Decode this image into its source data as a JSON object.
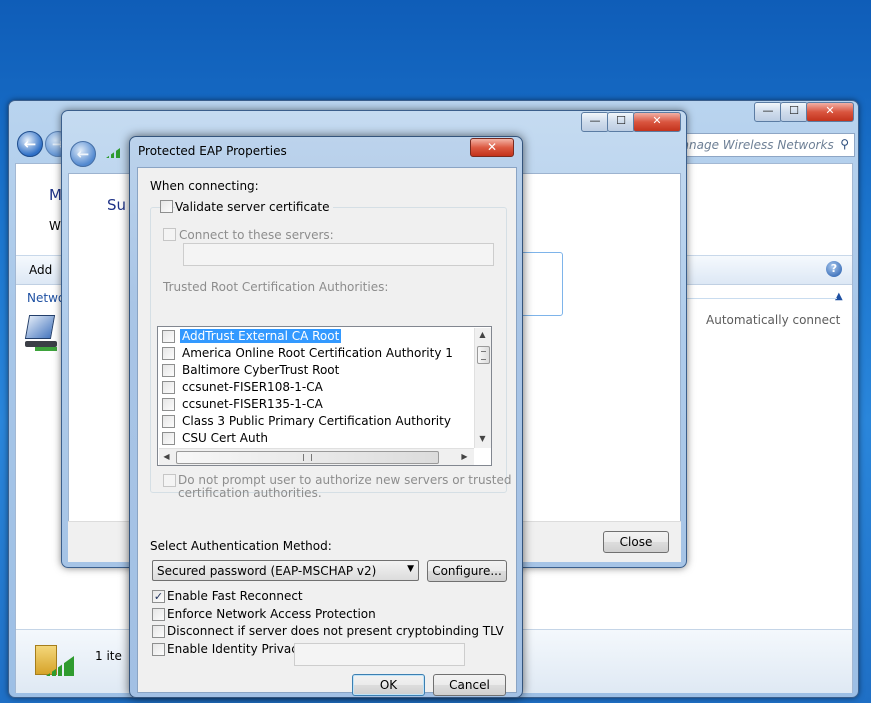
{
  "back_window": {
    "search_placeholder": "Search Manage Wireless Networks",
    "title_partial": "M",
    "subtitle_partial": "W",
    "toolbar_add": "Add",
    "networks_label_partial": "Netwo",
    "column_header": "Automatically connect",
    "status_count_partial": "1 ite",
    "caption_buttons": {
      "minimize": "—",
      "maximize": "☐",
      "close": "✕"
    }
  },
  "mid_window": {
    "heading_partial": "Su",
    "close_button": "Close",
    "caption_buttons": {
      "minimize": "—",
      "maximize": "☐",
      "close": "✕"
    }
  },
  "dialog": {
    "title": "Protected EAP Properties",
    "close_glyph": "✕",
    "when_connecting": "When connecting:",
    "validate_cert": {
      "label": "Validate server certificate",
      "checked": false
    },
    "connect_servers": {
      "label": "Connect to these servers:",
      "checked": false,
      "value": ""
    },
    "trusted_root_label": "Trusted Root Certification Authorities:",
    "ca_list": [
      {
        "name": "AddTrust External CA Root",
        "checked": false,
        "selected": true
      },
      {
        "name": "America Online Root Certification Authority 1",
        "checked": false,
        "selected": false
      },
      {
        "name": "Baltimore CyberTrust Root",
        "checked": false,
        "selected": false
      },
      {
        "name": "ccsunet-FISER108-1-CA",
        "checked": false,
        "selected": false
      },
      {
        "name": "ccsunet-FISER135-1-CA",
        "checked": false,
        "selected": false
      },
      {
        "name": "Class 3 Public Primary Certification Authority",
        "checked": false,
        "selected": false
      },
      {
        "name": "CSU Cert Auth",
        "checked": false,
        "selected": false
      }
    ],
    "do_not_prompt": {
      "line1": "Do not prompt user to authorize new servers or trusted",
      "line2": "certification authorities.",
      "checked": false
    },
    "auth_method_label": "Select Authentication Method:",
    "auth_method_value": "Secured password (EAP-MSCHAP v2)",
    "configure_button": "Configure...",
    "enable_fast_reconnect": {
      "label": "Enable Fast Reconnect",
      "checked": true
    },
    "enforce_nap": {
      "label": "Enforce Network Access Protection",
      "checked": false
    },
    "disconnect_tlv": {
      "label": "Disconnect if server does not present cryptobinding TLV",
      "checked": false
    },
    "identity_privacy": {
      "label": "Enable Identity Privacy",
      "checked": false,
      "value": ""
    },
    "ok_button": "OK",
    "cancel_button": "Cancel"
  }
}
